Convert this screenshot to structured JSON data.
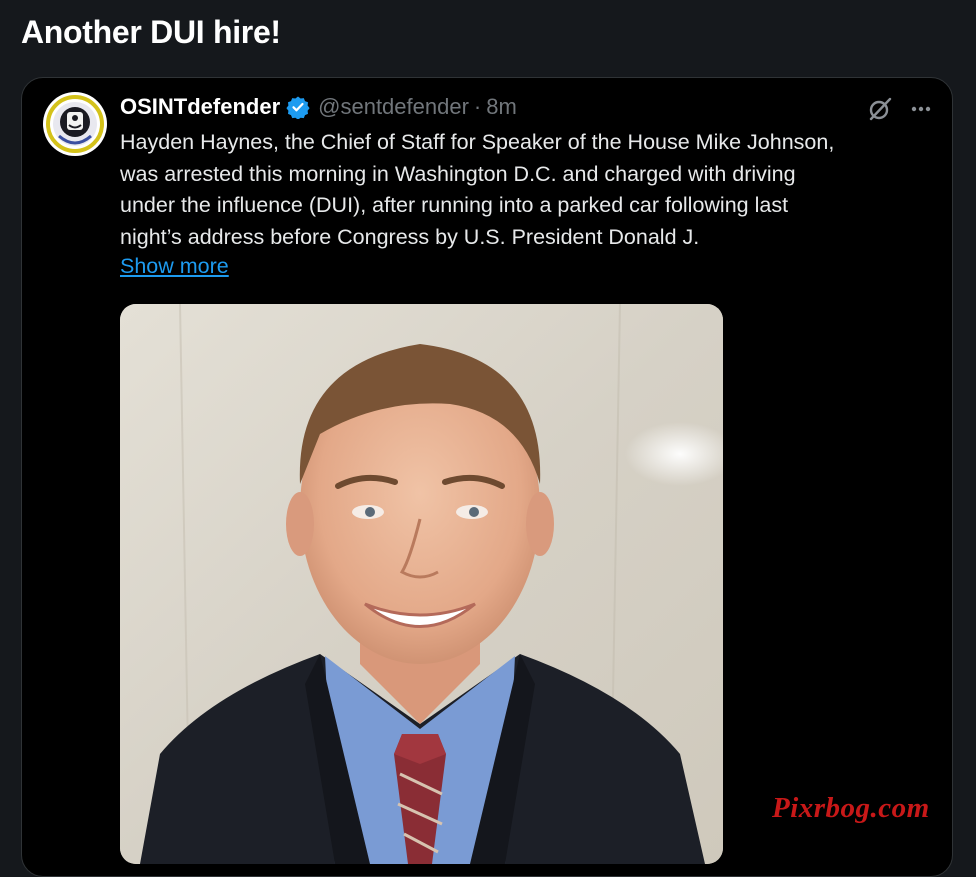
{
  "post": {
    "title": "Another DUI hire!"
  },
  "quoted_tweet": {
    "display_name": "OSINTdefender",
    "handle": "@sentdefender",
    "separator": "·",
    "time": "8m",
    "text_lines": [
      "Hayden Haynes, the Chief of Staff for Speaker of the House Mike Johnson,",
      "was arrested this morning in Washington D.C. and charged with driving",
      "under the influence (DUI), after running into a parked car following last",
      "night’s address before Congress by U.S. President Donald J."
    ],
    "show_more_label": "Show more",
    "icons": {
      "verified": "verified-badge-icon",
      "grok": "grok-icon",
      "more": "more-options-icon"
    }
  },
  "watermark": {
    "text": "Pixrbog.com"
  },
  "colors": {
    "background": "#15181c",
    "card": "#000000",
    "link": "#1d9bf0",
    "verified": "#1d9bf0",
    "muted": "#71767b",
    "watermark": "#c81818"
  }
}
